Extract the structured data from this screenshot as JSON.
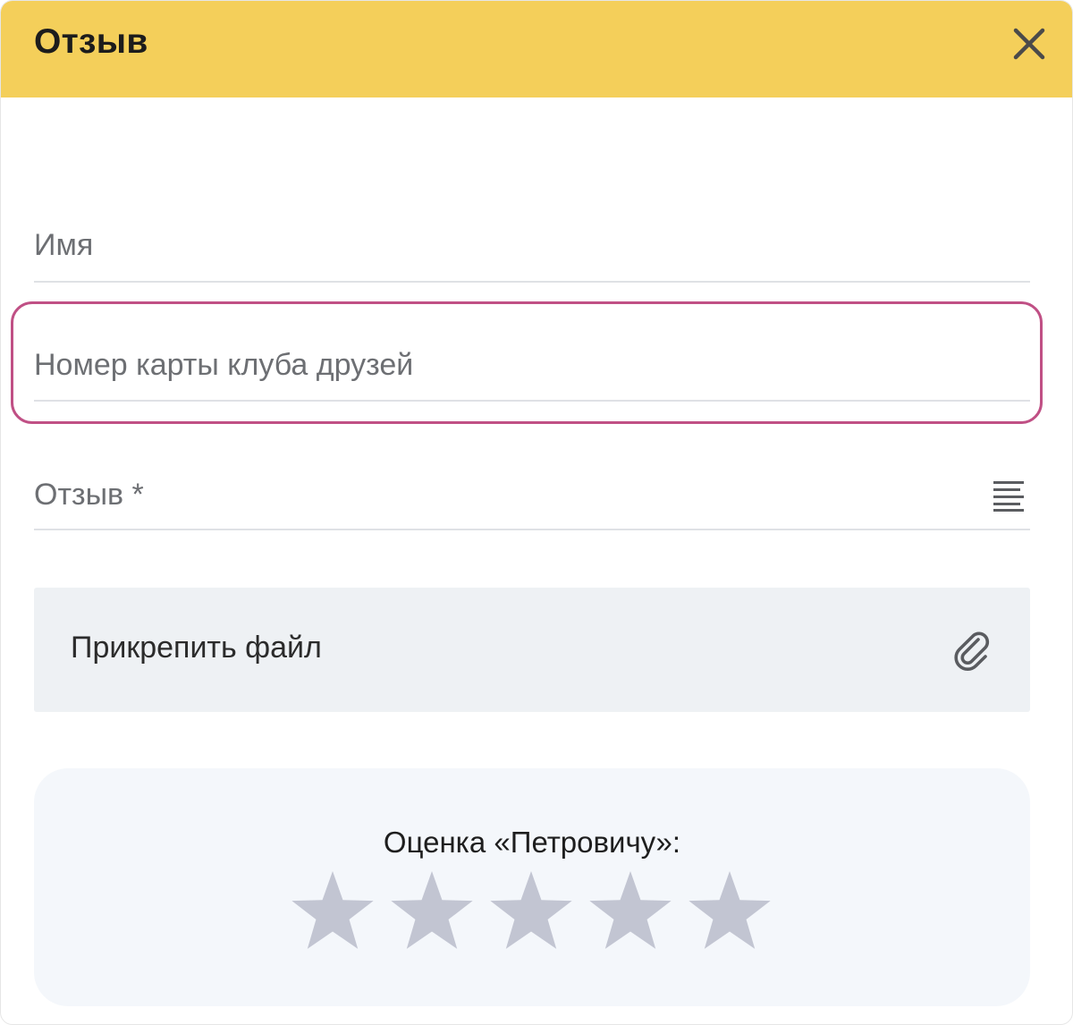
{
  "dialog": {
    "title": "Отзыв",
    "close_icon": "close-icon"
  },
  "form": {
    "name_placeholder": "Имя",
    "card_placeholder": "Номер карты клуба друзей",
    "review_placeholder": "Отзыв *",
    "review_icon": "text-align-icon",
    "attach_label": "Прикрепить файл",
    "attach_icon": "paperclip-icon"
  },
  "rating": {
    "label": "Оценка «Петровичу»:",
    "max": 5,
    "value": 0,
    "empty_color": "#c2c5d2"
  },
  "colors": {
    "header_bg": "#f4cf5a",
    "highlight": "#c05085",
    "attach_bg": "#eef1f4",
    "rating_bg": "#f4f7fb"
  }
}
